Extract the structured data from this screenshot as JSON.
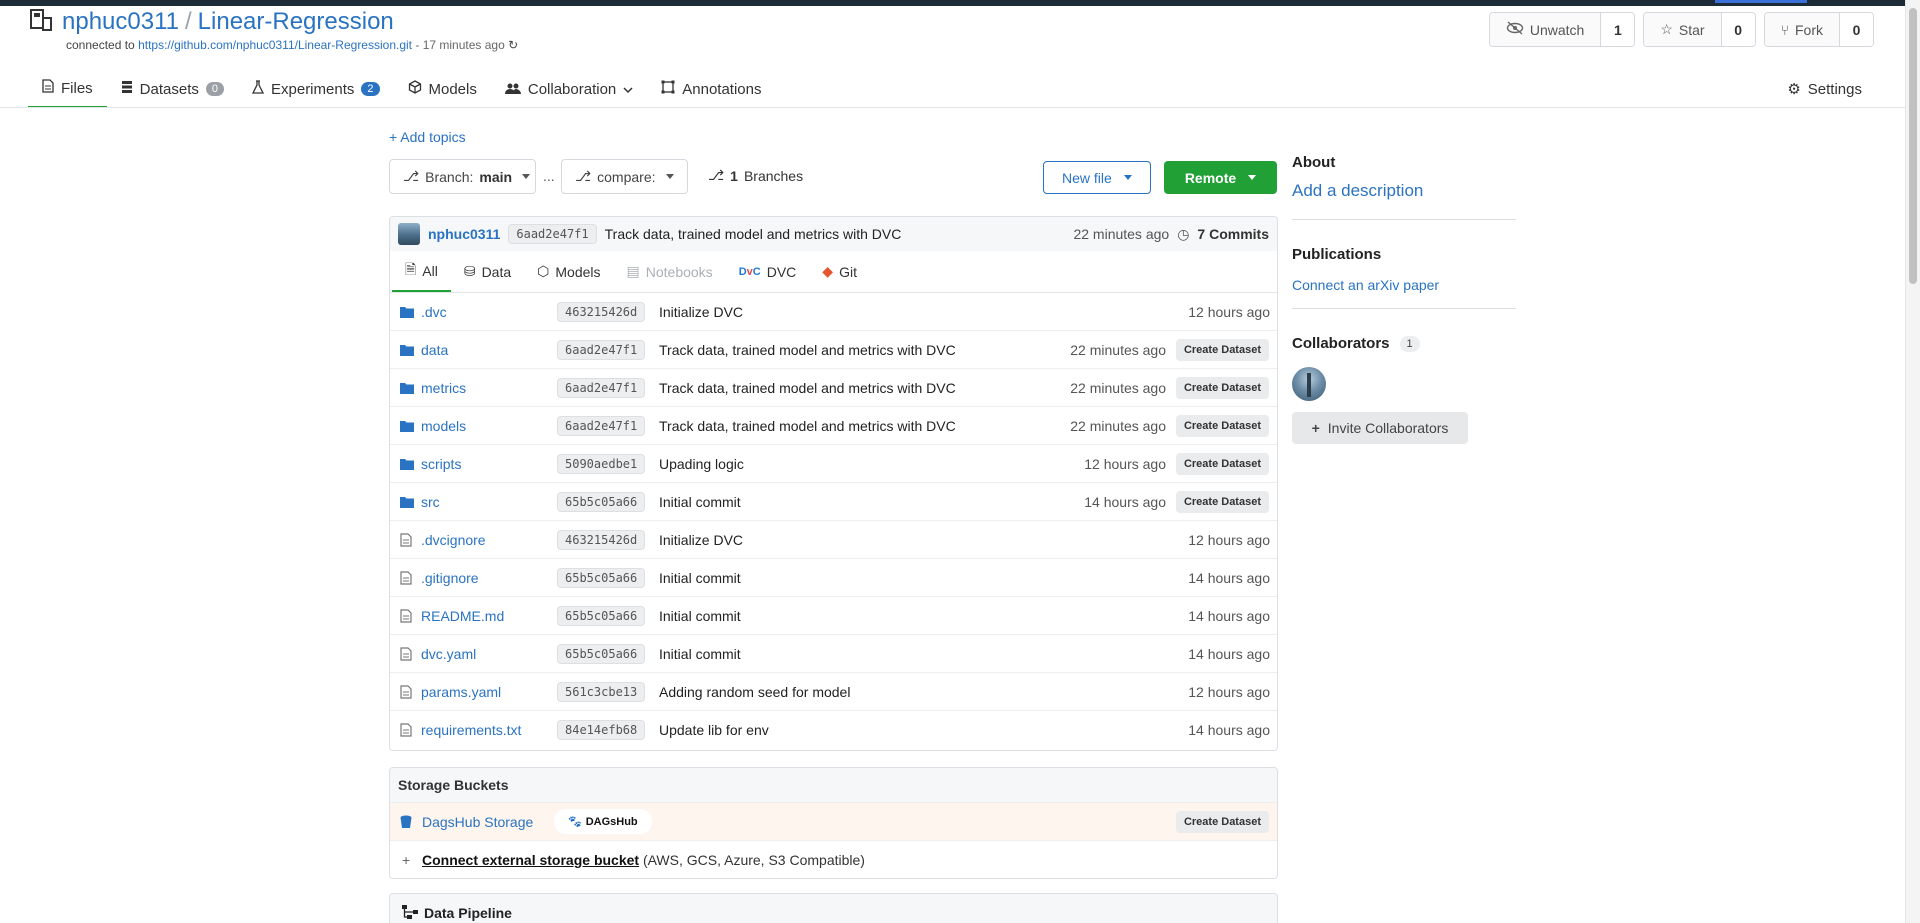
{
  "repo": {
    "owner": "nphuc0311",
    "separator": "/",
    "name": "Linear-Regression",
    "connected_prefix": "connected to",
    "connected_url": "https://github.com/nphuc0311/Linear-Regression.git",
    "connected_ago": "- 17 minutes ago"
  },
  "header_buttons": {
    "unwatch": {
      "label": "Unwatch",
      "count": "1",
      "icon": "eye-slash-icon"
    },
    "star": {
      "label": "Star",
      "count": "0",
      "icon": "star-icon"
    },
    "fork": {
      "label": "Fork",
      "count": "0",
      "icon": "fork-icon"
    }
  },
  "nav_tabs": [
    {
      "label": "Files",
      "icon": "file-icon",
      "active": true
    },
    {
      "label": "Datasets",
      "badge": "0",
      "icon": "database-icon"
    },
    {
      "label": "Experiments",
      "badge": "2",
      "icon": "flask-icon"
    },
    {
      "label": "Models",
      "icon": "cube-icon"
    },
    {
      "label": "Collaboration",
      "icon": "users-icon",
      "dropdown": true
    },
    {
      "label": "Annotations",
      "icon": "crop-icon"
    }
  ],
  "settings_label": "Settings",
  "toolbar": {
    "add_topics": "+ Add topics",
    "branch_prefix": "Branch:",
    "branch_value": "main",
    "dots": "...",
    "compare_label": "compare:",
    "branches_count": "1",
    "branches_label": "Branches",
    "new_file": "New file",
    "remote": "Remote"
  },
  "last_commit": {
    "user": "nphuc0311",
    "sha": "6aad2e47f1",
    "message": "Track data, trained model and metrics with DVC",
    "time": "22 minutes ago",
    "commits_count": "7",
    "commits_label": "Commits"
  },
  "file_tabs": [
    {
      "label": "All",
      "icon": "file-icon",
      "active": true
    },
    {
      "label": "Data",
      "icon": "drive-icon"
    },
    {
      "label": "Models",
      "icon": "cube-icon"
    },
    {
      "label": "Notebooks",
      "icon": "book-icon",
      "disabled": true
    },
    {
      "label": "DVC",
      "icon": "dvc-icon"
    },
    {
      "label": "Git",
      "icon": "git-icon"
    }
  ],
  "files": [
    {
      "name": ".dvc",
      "type": "folder",
      "sha": "463215426d",
      "message": "Initialize DVC",
      "time": "12 hours ago",
      "action": ""
    },
    {
      "name": "data",
      "type": "folder",
      "sha": "6aad2e47f1",
      "message": "Track data, trained model and metrics with DVC",
      "time": "22 minutes ago",
      "action": "Create Dataset"
    },
    {
      "name": "metrics",
      "type": "folder",
      "sha": "6aad2e47f1",
      "message": "Track data, trained model and metrics with DVC",
      "time": "22 minutes ago",
      "action": "Create Dataset"
    },
    {
      "name": "models",
      "type": "folder",
      "sha": "6aad2e47f1",
      "message": "Track data, trained model and metrics with DVC",
      "time": "22 minutes ago",
      "action": "Create Dataset"
    },
    {
      "name": "scripts",
      "type": "folder",
      "sha": "5090aedbe1",
      "message": "Upading logic",
      "time": "12 hours ago",
      "action": "Create Dataset"
    },
    {
      "name": "src",
      "type": "folder",
      "sha": "65b5c05a66",
      "message": "Initial commit",
      "time": "14 hours ago",
      "action": "Create Dataset"
    },
    {
      "name": ".dvcignore",
      "type": "file",
      "sha": "463215426d",
      "message": "Initialize DVC",
      "time": "12 hours ago",
      "action": ""
    },
    {
      "name": ".gitignore",
      "type": "file",
      "sha": "65b5c05a66",
      "message": "Initial commit",
      "time": "14 hours ago",
      "action": ""
    },
    {
      "name": "README.md",
      "type": "file",
      "sha": "65b5c05a66",
      "message": "Initial commit",
      "time": "14 hours ago",
      "action": ""
    },
    {
      "name": "dvc.yaml",
      "type": "file",
      "sha": "65b5c05a66",
      "message": "Initial commit",
      "time": "14 hours ago",
      "action": ""
    },
    {
      "name": "params.yaml",
      "type": "file",
      "sha": "561c3cbe13",
      "message": "Adding random seed for model",
      "time": "12 hours ago",
      "action": ""
    },
    {
      "name": "requirements.txt",
      "type": "file",
      "sha": "84e14efb68",
      "message": "Update lib for env",
      "time": "14 hours ago",
      "action": ""
    }
  ],
  "storage": {
    "title": "Storage Buckets",
    "bucket_name": "DagsHub Storage",
    "logo_text": "DAGsHub",
    "action": "Create Dataset",
    "connect_plus": "+",
    "connect_link": "Connect external storage bucket",
    "connect_note": "(AWS, GCS, Azure, S3 Compatible)"
  },
  "pipeline_title": "Data Pipeline",
  "sidebar": {
    "about_title": "About",
    "add_description": "Add a description",
    "publications_title": "Publications",
    "connect_arxiv": "Connect an arXiv paper",
    "collaborators_title": "Collaborators",
    "collaborators_count": "1",
    "invite_label": "Invite Collaborators"
  },
  "colors": {
    "accent_green": "#21a035",
    "link_blue": "#2a73c2",
    "topbar": "#1d2b36"
  }
}
